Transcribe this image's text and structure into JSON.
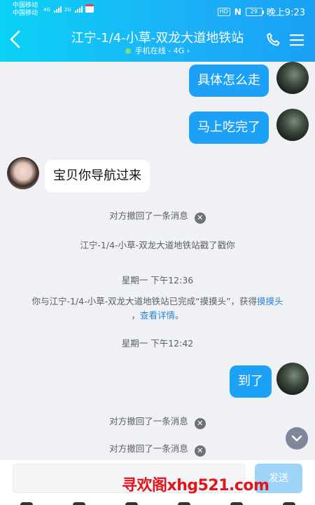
{
  "status_bar": {
    "carrier1": "中国移动",
    "carrier2": "中国移动",
    "net1": "4G",
    "net2": "2G",
    "hd": "HD",
    "battery": "29",
    "time": "晚上9:23"
  },
  "header": {
    "title": "江宁-1/4-小草-双龙大道地铁站",
    "subtitle": "手机在线 - 4G",
    "subtitle_arrow": "›"
  },
  "messages": {
    "m1": "具体怎么走",
    "m2": "马上吃完了",
    "m3": "宝贝你导航过来",
    "sys1": "对方撤回了一条消息",
    "sys2": "江宁-1/4-小草-双龙大道地铁站戳了戳你",
    "time1": "星期一 下午12:36",
    "sys3_text": "你与江宁-1/4-小草-双龙大道地铁站已完成“摸摸头”，获得",
    "sys3_link": "摸摸头",
    "sys3_comma": "，",
    "sys3_details": "查看详情",
    "sys3_end": "。",
    "time2": "星期一 下午12:42",
    "m4": "到了",
    "sys4": "对方撤回了一条消息",
    "sys5": "对方撤回了一条消息",
    "close_glyph": "✕"
  },
  "input_bar": {
    "placeholder": "",
    "send_label": "发送"
  },
  "watermark": "寻欢阁xhg521.com",
  "colors": {
    "header_start": "#0ad2f6",
    "header_end": "#1aa0f5",
    "outgoing_bubble": "#1da1f7",
    "link": "#2a86d6",
    "watermark": "#e3141b"
  },
  "icons": [
    "back-arrow-icon",
    "phone-icon",
    "menu-icon",
    "close-icon",
    "chevron-down-icon",
    "avatar"
  ]
}
